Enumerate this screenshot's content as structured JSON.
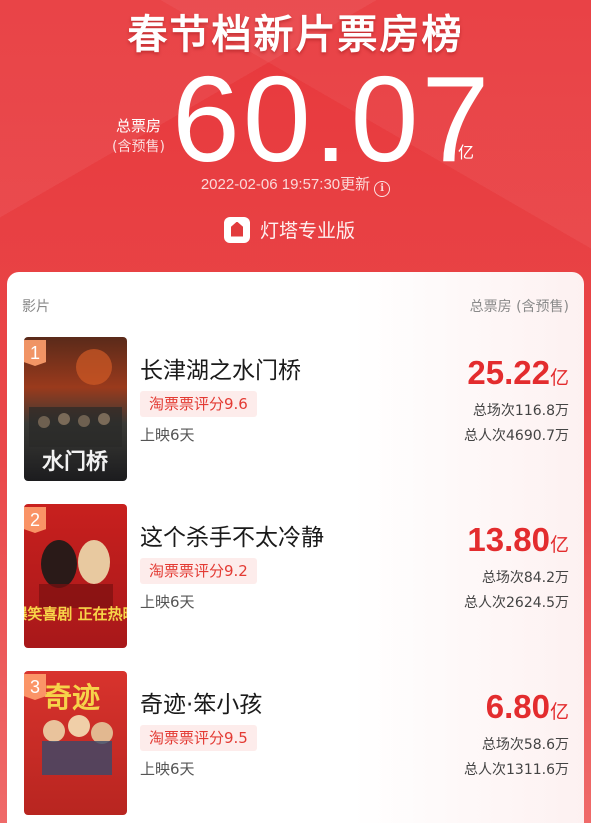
{
  "header": {
    "title": "春节档新片票房榜",
    "total_label": "总票房",
    "total_sublabel": "(含预售)",
    "total_value": "60.07",
    "total_unit": "亿",
    "update_time": "2022-02-06 19:57:30更新",
    "brand": "灯塔专业版"
  },
  "table": {
    "col_left": "影片",
    "col_right": "总票房 (含预售)"
  },
  "movies": [
    {
      "rank": "1",
      "title": "长津湖之水门桥",
      "rating": "淘票票评分9.6",
      "days": "上映6天",
      "gross": "25.22",
      "gross_unit": "亿",
      "sessions": "总场次116.8万",
      "admissions": "总人次4690.7万",
      "poster_text": "水门桥"
    },
    {
      "rank": "2",
      "title": "这个杀手不太冷静",
      "rating": "淘票票评分9.2",
      "days": "上映6天",
      "gross": "13.80",
      "gross_unit": "亿",
      "sessions": "总场次84.2万",
      "admissions": "总人次2624.5万",
      "poster_text": "爆笑喜剧 正在热映"
    },
    {
      "rank": "3",
      "title": "奇迹·笨小孩",
      "rating": "淘票票评分9.5",
      "days": "上映6天",
      "gross": "6.80",
      "gross_unit": "亿",
      "sessions": "总场次58.6万",
      "admissions": "总人次1311.6万",
      "poster_text": "奇迹"
    }
  ]
}
